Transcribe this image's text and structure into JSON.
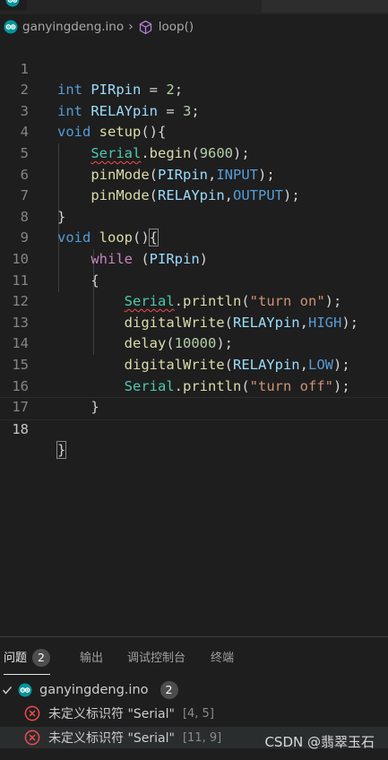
{
  "breadcrumb": {
    "file": "ganyingdeng.ino",
    "symbol": "loop()"
  },
  "editor": {
    "line_numbers": [
      "1",
      "2",
      "3",
      "4",
      "5",
      "6",
      "7",
      "8",
      "9",
      "10",
      "11",
      "12",
      "13",
      "14",
      "15",
      "16",
      "17",
      "18"
    ],
    "code": {
      "l1": {
        "t": "int",
        "v": "PIRpin",
        "eq": " = ",
        "n": "2",
        "e": ";"
      },
      "l2": {
        "t": "int",
        "v": "RELAYpin",
        "eq": " = ",
        "n": "3",
        "e": ";"
      },
      "l3": {
        "t": "void",
        "f": "setup",
        "e": "(){"
      },
      "l4": {
        "c": "Serial",
        "d": ".",
        "f": "begin",
        "o": "(",
        "n": "9600",
        "e": ");"
      },
      "l5": {
        "f": "pinMode",
        "o": "(",
        "v": "PIRpin",
        "s": ",",
        "k": "INPUT",
        "e": ");"
      },
      "l6": {
        "f": "pinMode",
        "o": "(",
        "v": "RELAYpin",
        "s": ",",
        "k": "OUTPUT",
        "e": ");"
      },
      "l7": {
        "e": "}"
      },
      "l8": {
        "t": "void",
        "f": "loop",
        "o": "()",
        "b": "{"
      },
      "l9": {
        "w": "while",
        "o": " (",
        "v": "PIRpin",
        "e": ")"
      },
      "l10": {
        "e": "{"
      },
      "l11": {
        "c": "Serial",
        "d": ".",
        "f": "println",
        "o": "(",
        "str": "\"turn on\"",
        "e": ");"
      },
      "l12": {
        "f": "digitalWrite",
        "o": "(",
        "v": "RELAYpin",
        "s": ",",
        "k": "HIGH",
        "e": ");"
      },
      "l13": {
        "f": "delay",
        "o": "(",
        "n": "10000",
        "e": ");"
      },
      "l14": {
        "f": "digitalWrite",
        "o": "(",
        "v": "RELAYpin",
        "s": ",",
        "k": "LOW",
        "e": ");"
      },
      "l15": {
        "c": "Serial",
        "d": ".",
        "f": "println",
        "o": "(",
        "str": "\"turn off\"",
        "e": ");"
      },
      "l16": {
        "e": "}"
      },
      "l18": {
        "b": "}"
      }
    }
  },
  "panel": {
    "tabs": [
      {
        "label": "问题",
        "count": "2"
      },
      {
        "label": "输出"
      },
      {
        "label": "调试控制台"
      },
      {
        "label": "终端"
      }
    ],
    "file": {
      "name": "ganyingdeng.ino",
      "count": "2"
    },
    "problems": [
      {
        "message": "未定义标识符 \"Serial\"",
        "location": "[4, 5]"
      },
      {
        "message": "未定义标识符 \"Serial\"",
        "location": "[11, 9]"
      }
    ]
  },
  "watermark": "CSDN @翡翠玉石",
  "icons": {
    "breadcrumb_file": "arduino-icon",
    "breadcrumb_symbol": "method-cube-icon",
    "expand": "check-chevron-icon",
    "problem": "error-circle-icon"
  },
  "colors": {
    "background": "#1e1e1e",
    "keyword": "#569cd6",
    "control": "#c586c0",
    "variable": "#9cdcfe",
    "function": "#dcdcaa",
    "number": "#b5cea8",
    "string": "#ce9178",
    "class": "#4ec9b0",
    "constant": "#4fc1ff",
    "error": "#f14c4c",
    "arduino": "#00979d"
  }
}
